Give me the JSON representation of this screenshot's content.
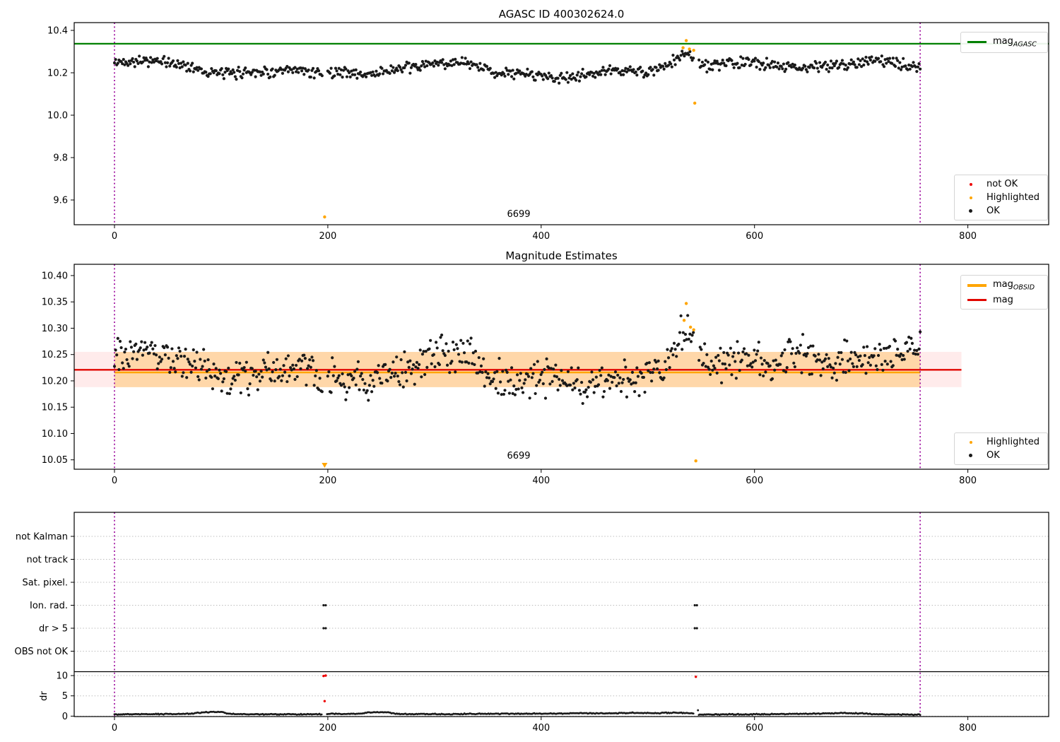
{
  "figure": {
    "panel1_title": "AGASC ID 400302624.0",
    "panel2_title": "Magnitude Estimates"
  },
  "annotations": {
    "panel1_obsid_label": "6699",
    "panel2_obsid_label": "6699"
  },
  "legends": {
    "mag_agasc": {
      "prefix": "mag",
      "sub": "AGASC"
    },
    "mag_obsid": {
      "prefix": "mag",
      "sub": "OBSID"
    },
    "mag": "mag",
    "not_ok": "not OK",
    "highlighted": "Highlighted",
    "ok": "OK"
  },
  "colors": {
    "ok_marker": "#1a1a1a",
    "not_ok_marker": "#ee0000",
    "highlighted_marker": "#ffa500",
    "mag_agasc_line": "#008000",
    "mag_line": "#e10600",
    "mag_obsid_line": "#ffa500",
    "obsid_boundary_line": "#990099",
    "mag_band_fill": "rgba(255,0,0,0.08)",
    "obsid_band_fill": "rgba(255,165,0,0.28)",
    "grid_dotted": "#bcbcbc",
    "separator_line": "#000000"
  },
  "chart_data": [
    {
      "type": "scatter",
      "title": "AGASC ID 400302624.0",
      "xlim": [
        -38,
        876
      ],
      "ylim": [
        9.483,
        10.437
      ],
      "xticks": [
        0,
        200,
        400,
        600,
        800
      ],
      "xtick_labels": [
        "0",
        "200",
        "400",
        "600",
        "800"
      ],
      "ytick_values": [
        10.4,
        10.2,
        10.0,
        9.8,
        9.6
      ],
      "ytick_labels": [
        "10.4",
        "10.2",
        "10.0",
        "9.8",
        "9.6"
      ],
      "hlines": [
        {
          "name": "mag_AGASC",
          "y": 10.337,
          "x_span": [
            -38,
            876
          ],
          "color": "#008000"
        }
      ],
      "vlines": [
        {
          "name": "obsid_start",
          "x": 0
        },
        {
          "name": "obsid_end",
          "x": 755.3
        }
      ],
      "annotation": {
        "text": "6699",
        "x": 378,
        "y_px_offset": "near_bottom"
      },
      "ok_series": {
        "n": 715,
        "x_range": [
          0,
          755.3
        ],
        "gaps_at_x": [
          197,
          545
        ],
        "mean_control_points": [
          [
            0,
            10.245
          ],
          [
            10,
            10.255
          ],
          [
            25,
            10.26
          ],
          [
            45,
            10.25
          ],
          [
            60,
            10.24
          ],
          [
            75,
            10.225
          ],
          [
            90,
            10.2
          ],
          [
            110,
            10.195
          ],
          [
            130,
            10.21
          ],
          [
            150,
            10.2
          ],
          [
            170,
            10.21
          ],
          [
            197,
            10.2
          ],
          [
            215,
            10.205
          ],
          [
            235,
            10.19
          ],
          [
            255,
            10.21
          ],
          [
            275,
            10.22
          ],
          [
            295,
            10.24
          ],
          [
            320,
            10.25
          ],
          [
            340,
            10.23
          ],
          [
            360,
            10.2
          ],
          [
            380,
            10.195
          ],
          [
            400,
            10.19
          ],
          [
            420,
            10.17
          ],
          [
            435,
            10.185
          ],
          [
            455,
            10.2
          ],
          [
            475,
            10.215
          ],
          [
            495,
            10.2
          ],
          [
            515,
            10.22
          ],
          [
            528,
            10.27
          ],
          [
            537,
            10.295
          ],
          [
            545,
            10.26
          ],
          [
            555,
            10.23
          ],
          [
            575,
            10.24
          ],
          [
            595,
            10.25
          ],
          [
            615,
            10.24
          ],
          [
            635,
            10.23
          ],
          [
            655,
            10.225
          ],
          [
            675,
            10.235
          ],
          [
            695,
            10.25
          ],
          [
            715,
            10.26
          ],
          [
            735,
            10.24
          ],
          [
            755,
            10.225
          ]
        ],
        "noise_amp": 0.032,
        "seed": 42
      },
      "highlighted_points": [
        [
          197,
          9.52
        ],
        [
          533,
          10.318
        ],
        [
          536,
          10.352
        ],
        [
          539,
          10.312
        ],
        [
          543,
          10.306
        ],
        [
          544,
          10.057
        ]
      ]
    },
    {
      "type": "scatter",
      "title": "Magnitude Estimates",
      "xlim": [
        -38,
        876
      ],
      "ylim": [
        10.032,
        10.421
      ],
      "xticks": [
        0,
        200,
        400,
        600,
        800
      ],
      "xtick_labels": [
        "0",
        "200",
        "400",
        "600",
        "800"
      ],
      "ytick_values": [
        10.4,
        10.35,
        10.3,
        10.25,
        10.2,
        10.15,
        10.1,
        10.05
      ],
      "ytick_labels": [
        "10.40",
        "10.35",
        "10.30",
        "10.25",
        "10.20",
        "10.15",
        "10.10",
        "10.05"
      ],
      "hlines": [
        {
          "name": "mag",
          "y": 10.221,
          "x_span": [
            -38,
            794
          ],
          "color": "#e10600"
        },
        {
          "name": "mag_OBSID",
          "y": 10.216,
          "x_span": [
            0,
            755.3
          ],
          "color": "#ffa500"
        }
      ],
      "bands": [
        {
          "name": "mag_uncertainty",
          "y_range": [
            10.188,
            10.255
          ],
          "x_span": [
            -38,
            794
          ],
          "fill": "rgba(255,0,0,0.08)"
        },
        {
          "name": "obsid_uncertainty",
          "y_range": [
            10.188,
            10.255
          ],
          "x_span": [
            0,
            755.3
          ],
          "fill": "rgba(255,165,0,0.28)"
        }
      ],
      "vlines": [
        {
          "name": "obsid_start",
          "x": 0
        },
        {
          "name": "obsid_end",
          "x": 755.3
        }
      ],
      "annotation": {
        "text": "6699",
        "x": 378,
        "y_px_offset": "near_bottom"
      },
      "ok_series": {
        "n": 715,
        "x_range": [
          0,
          755.3
        ],
        "gaps_at_x": [
          197,
          545
        ],
        "mean_control_points": [
          [
            0,
            10.25
          ],
          [
            12,
            10.26
          ],
          [
            30,
            10.262
          ],
          [
            50,
            10.252
          ],
          [
            70,
            10.235
          ],
          [
            90,
            10.212
          ],
          [
            115,
            10.205
          ],
          [
            140,
            10.215
          ],
          [
            165,
            10.222
          ],
          [
            197,
            10.21
          ],
          [
            215,
            10.2
          ],
          [
            240,
            10.198
          ],
          [
            262,
            10.212
          ],
          [
            288,
            10.242
          ],
          [
            312,
            10.252
          ],
          [
            332,
            10.248
          ],
          [
            348,
            10.215
          ],
          [
            365,
            10.198
          ],
          [
            385,
            10.202
          ],
          [
            405,
            10.208
          ],
          [
            422,
            10.192
          ],
          [
            437,
            10.182
          ],
          [
            452,
            10.197
          ],
          [
            468,
            10.21
          ],
          [
            485,
            10.2
          ],
          [
            502,
            10.205
          ],
          [
            518,
            10.225
          ],
          [
            530,
            10.285
          ],
          [
            540,
            10.3
          ],
          [
            548,
            10.25
          ],
          [
            562,
            10.228
          ],
          [
            580,
            10.235
          ],
          [
            598,
            10.24
          ],
          [
            615,
            10.23
          ],
          [
            632,
            10.246
          ],
          [
            648,
            10.252
          ],
          [
            660,
            10.235
          ],
          [
            675,
            10.232
          ],
          [
            690,
            10.242
          ],
          [
            705,
            10.252
          ],
          [
            720,
            10.248
          ],
          [
            735,
            10.245
          ],
          [
            748,
            10.26
          ],
          [
            755,
            10.262
          ]
        ],
        "noise_amp": 0.042,
        "seed": 77
      },
      "highlighted_points": [
        [
          536,
          10.347
        ],
        [
          534,
          10.315
        ],
        [
          540,
          10.302
        ],
        [
          543,
          10.297
        ],
        [
          545,
          10.048
        ]
      ],
      "clipped_markers": [
        {
          "x": 197,
          "symbol": "triangle-down",
          "color": "#ffa500",
          "meaning": "point below axis"
        }
      ]
    },
    {
      "type": "scatter",
      "title": "",
      "xlim": [
        -38,
        876
      ],
      "xticks": [
        0,
        200,
        400,
        600,
        800
      ],
      "xtick_labels": [
        "0",
        "200",
        "400",
        "600",
        "800"
      ],
      "flag_categories": [
        "not Kalman",
        "not track",
        "Sat. pixel.",
        "Ion. rad.",
        "dr > 5",
        "OBS not OK"
      ],
      "dr_axis": {
        "label": "dr",
        "ticks": [
          10,
          5,
          0
        ],
        "tick_labels": [
          "10",
          "5",
          "0"
        ]
      },
      "separator_line": true,
      "vlines": [
        {
          "name": "obsid_start",
          "x": 0
        },
        {
          "name": "obsid_end",
          "x": 755.3
        }
      ],
      "flag_points": [
        {
          "category": "Ion. rad.",
          "x": [
            196,
            198,
            544,
            546
          ],
          "color": "#1a1a1a"
        },
        {
          "category": "dr > 5",
          "x": [
            196,
            198,
            544,
            546
          ],
          "color": "#1a1a1a"
        }
      ],
      "not_ok_points_dr": [
        [
          196,
          9.9
        ],
        [
          198,
          10.0
        ],
        [
          197,
          3.7
        ],
        [
          545,
          9.7
        ]
      ],
      "dr_outliers": [
        [
          547,
          1.45
        ]
      ],
      "dr_series": {
        "n": 740,
        "x_range": [
          0,
          755.3
        ],
        "gaps_at_x": [
          197,
          545
        ],
        "mean_control_points": [
          [
            0,
            0.45
          ],
          [
            40,
            0.5
          ],
          [
            70,
            0.55
          ],
          [
            85,
            1.0
          ],
          [
            100,
            1.05
          ],
          [
            107,
            0.55
          ],
          [
            140,
            0.45
          ],
          [
            196,
            0.45
          ],
          [
            198,
            0.55
          ],
          [
            230,
            0.6
          ],
          [
            238,
            0.95
          ],
          [
            258,
            0.9
          ],
          [
            264,
            0.55
          ],
          [
            300,
            0.5
          ],
          [
            340,
            0.55
          ],
          [
            380,
            0.6
          ],
          [
            420,
            0.65
          ],
          [
            440,
            0.75
          ],
          [
            460,
            0.65
          ],
          [
            485,
            0.8
          ],
          [
            510,
            0.75
          ],
          [
            530,
            0.85
          ],
          [
            544,
            0.6
          ],
          [
            548,
            0.4
          ],
          [
            590,
            0.45
          ],
          [
            620,
            0.5
          ],
          [
            655,
            0.6
          ],
          [
            680,
            0.75
          ],
          [
            700,
            0.7
          ],
          [
            715,
            0.45
          ],
          [
            740,
            0.4
          ],
          [
            755,
            0.35
          ]
        ],
        "noise_amp": 0.1,
        "seed": 99
      }
    }
  ]
}
